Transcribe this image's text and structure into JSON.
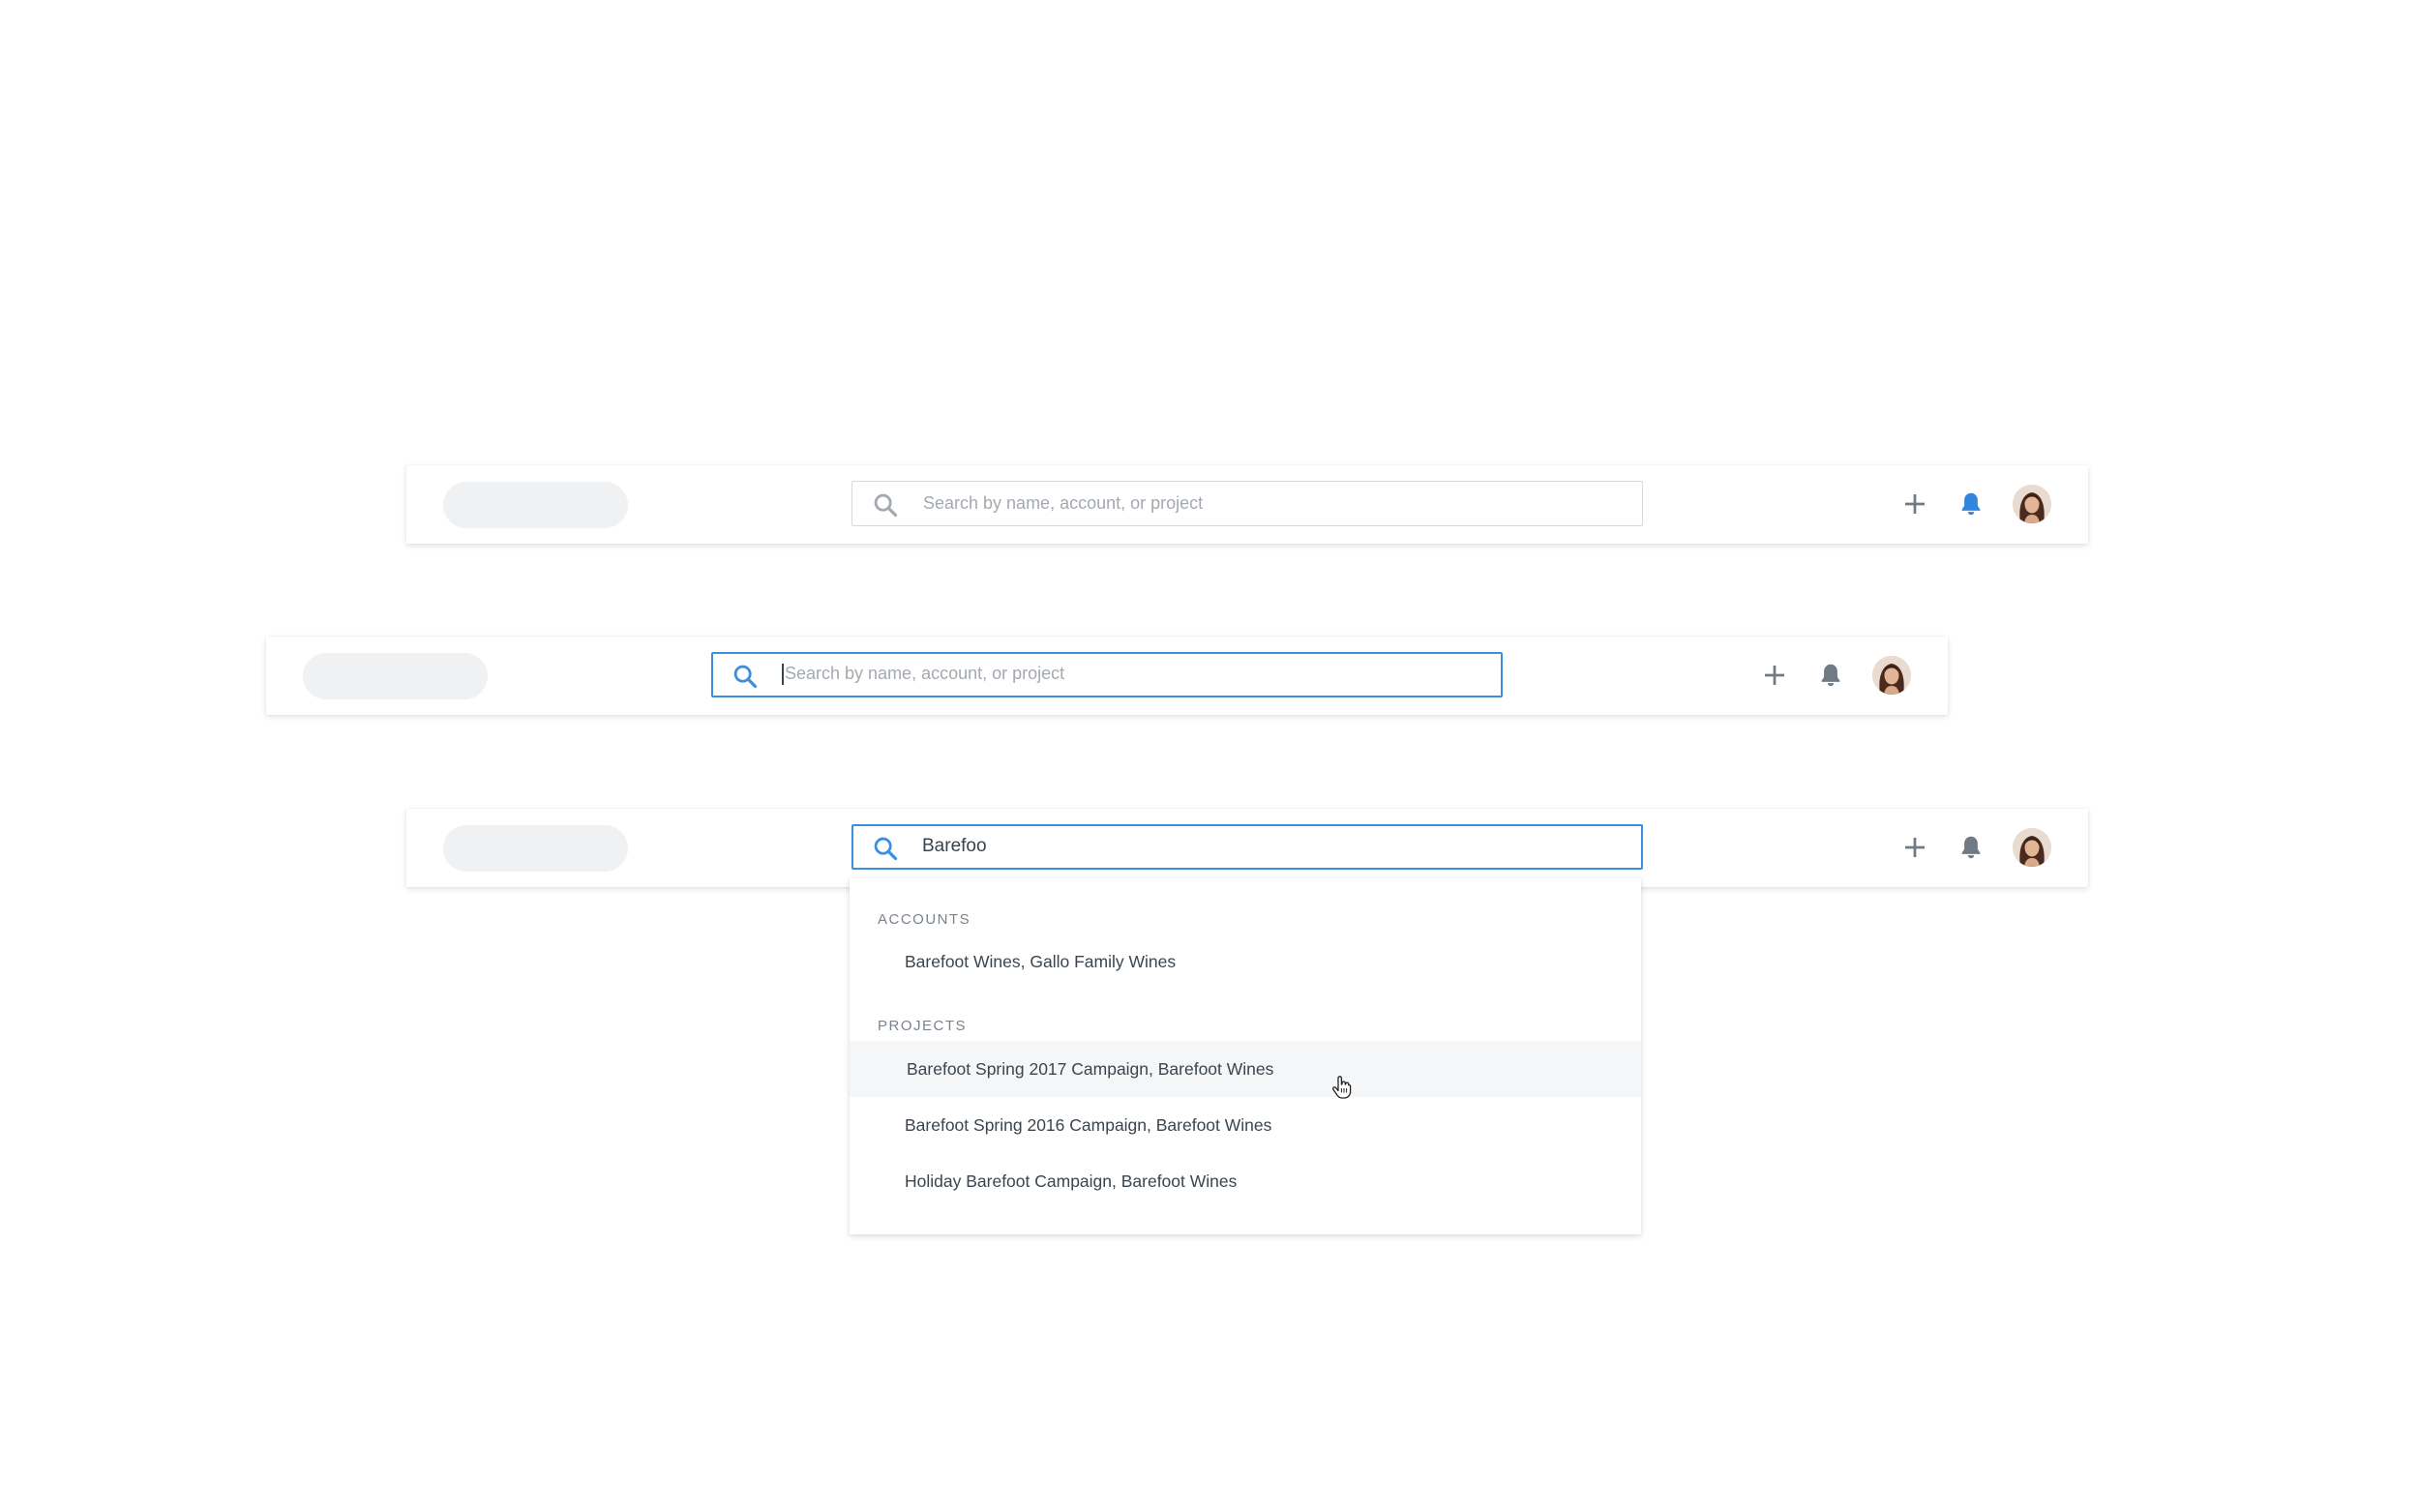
{
  "search": {
    "placeholder": "Search by name, account, or project",
    "query": "Barefoo"
  },
  "dropdown": {
    "accounts_label": "ACCOUNTS",
    "accounts": [
      "Barefoot Wines, Gallo Family Wines"
    ],
    "projects_label": "PROJECTS",
    "projects": [
      "Barefoot Spring 2017 Campaign, Barefoot Wines",
      "Barefoot Spring 2016 Campaign, Barefoot Wines",
      "Holiday Barefoot Campaign, Barefoot Wines"
    ]
  },
  "icons": {
    "search": "search-icon",
    "add": "plus-icon",
    "notifications": "bell-icon",
    "profile": "avatar",
    "pointer": "hand-pointer-icon"
  },
  "colors": {
    "accent": "#3b8fdc",
    "bell_active": "#2f86de",
    "icon_gray": "#707a84",
    "placeholder_text": "#a3a9af",
    "hover_row": "#f5f6f7"
  }
}
